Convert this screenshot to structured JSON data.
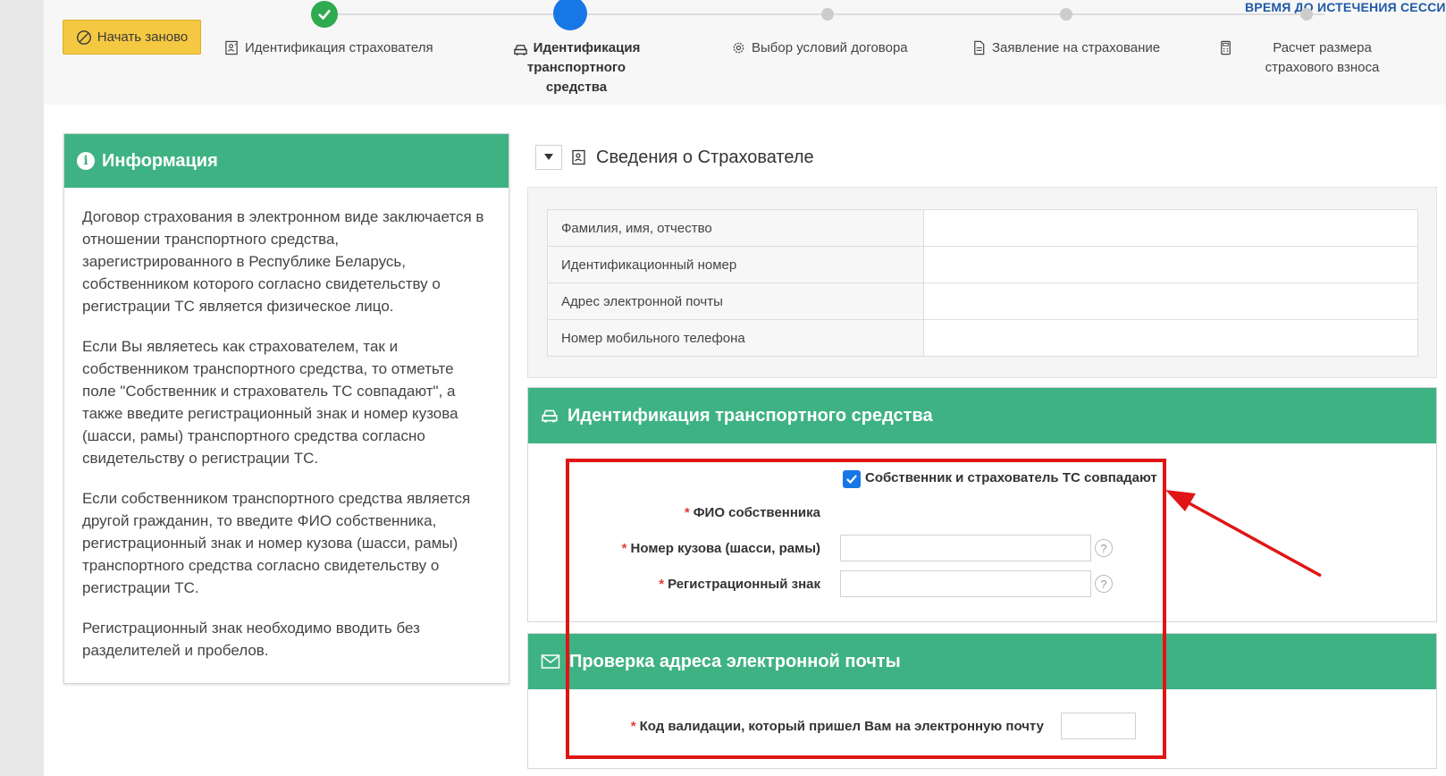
{
  "header": {
    "restart_label": "Начать заново",
    "session_label": "ВРЕМЯ ДО ИСТЕЧЕНИЯ СЕССИИ:"
  },
  "steps": [
    {
      "label": "Идентификация страхователя",
      "state": "done",
      "icon": "id-card-icon"
    },
    {
      "label": "Идентификация транспортного средства",
      "state": "active",
      "icon": "car-icon"
    },
    {
      "label": "Выбор условий договора",
      "state": "pending",
      "icon": "gear-icon"
    },
    {
      "label": "Заявление на страхование",
      "state": "pending",
      "icon": "document-icon"
    },
    {
      "label": "Расчет размера страхового взноса",
      "state": "pending",
      "icon": "calculator-icon"
    }
  ],
  "info": {
    "title": "Информация",
    "paragraphs": [
      "Договор страхования в электронном виде заключается в отношении транспортного средства, зарегистрированного в Республике Беларусь, собственником которого согласно свидетельству о регистрации ТС является физическое лицо.",
      "Если Вы являетесь как страхователем, так и собственником транспортного средства, то отметьте поле \"Собственник и страхователь ТС совпадают\", а также введите регистрационный знак и номер кузова (шасси, рамы) транспортного средства согласно свидетельству о регистрации ТС.",
      "Если собственником транспортного средства является другой гражданин, то введите ФИО собственника, регистрационный знак и номер кузова (шасси, рамы) транспортного средства согласно свидетельству о регистрации ТС.",
      "Регистрационный знак необходимо вводить без разделителей и пробелов."
    ]
  },
  "insurer": {
    "title": "Сведения о Страхователе",
    "rows": [
      {
        "label": "Фамилия, имя, отчество",
        "value": ""
      },
      {
        "label": "Идентификационный номер",
        "value": ""
      },
      {
        "label": "Адрес электронной почты",
        "value": ""
      },
      {
        "label": "Номер мобильного телефона",
        "value": ""
      }
    ]
  },
  "vehicle": {
    "title": "Идентификация транспортного средства",
    "checkbox_label": "Собственник и страхователь ТС совпадают",
    "checkbox_checked": true,
    "owner_label": "ФИО собственника",
    "body_number_label": "Номер кузова (шасси, рамы)",
    "body_number_value": "",
    "reg_sign_label": "Регистрационный знак",
    "reg_sign_value": "",
    "required_mark": "*",
    "help_mark": "?"
  },
  "email_check": {
    "title": "Проверка адреса электронной почты",
    "code_label": "Код валидации, который пришел Вам на электронную почту",
    "code_value": ""
  },
  "colors": {
    "accent_green": "#3fb284",
    "active_blue": "#1877e6",
    "done_green": "#2eaa4f",
    "restart_yellow": "#f5c842",
    "annotation_red": "#e01515"
  }
}
